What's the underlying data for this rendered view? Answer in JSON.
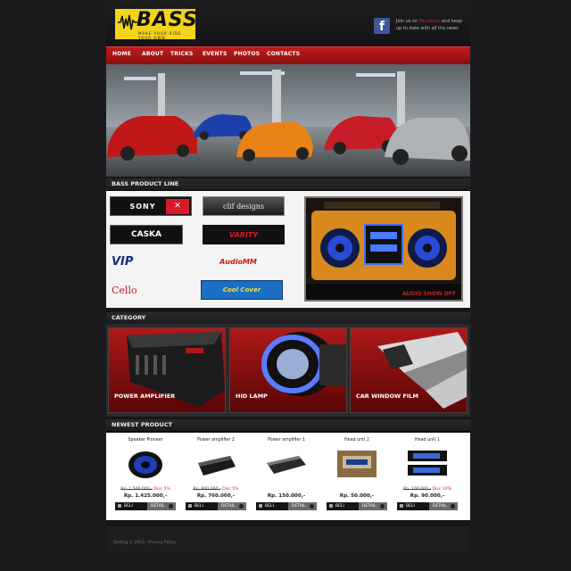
{
  "logo": {
    "text": "BASS",
    "tagline": "MAKE YOUR RIDE YOUR OWN"
  },
  "social": {
    "pre": "Join us on ",
    "highlight": "Facebook",
    "post": " and keep up to date with all the news"
  },
  "nav": [
    "HOME",
    "ABOUT",
    "TRICKS",
    "EVENTS",
    "PHOTOS",
    "CONTACTS"
  ],
  "sections": {
    "product_line": "BASS PRODUCT LINE",
    "category": "CATEGORY",
    "newest": "NEWEST PRODUCT"
  },
  "brands": [
    "SONY",
    "clif designs",
    "CASKA",
    "VARITY",
    "VIP",
    "AudioMM",
    "Cello",
    "Cool Cover"
  ],
  "showoff_label": "AUDIO SHOW OFF",
  "categories": [
    "POWER AMPLIFIER",
    "HID LAMP",
    "CAR WINDOW FILM"
  ],
  "products": [
    {
      "name": "Speaker Pioneer",
      "old": "Rp. 1.500.000,-",
      "disc": "Disc 5%",
      "price": "Rp. 1.425.000,-",
      "buy": "BELI",
      "detail": "DETAIL"
    },
    {
      "name": "Power amplifier 2",
      "old": "Rp. 800.000,-",
      "disc": "Disc 5%",
      "price": "Rp. 760.000,-",
      "buy": "BELI",
      "detail": "DETAIL"
    },
    {
      "name": "Power amplifier 1",
      "old": "",
      "disc": "",
      "price": "Rp. 150.000,-",
      "buy": "BELI",
      "detail": "DETAIL"
    },
    {
      "name": "Head unit 2",
      "old": "",
      "disc": "",
      "price": "Rp. 50.000,-",
      "buy": "BELI",
      "detail": "DETAIL"
    },
    {
      "name": "Head unit 1",
      "old": "Rp. 100.000,-",
      "disc": "Disc 10%",
      "price": "Rp. 90.000,-",
      "buy": "BELI",
      "detail": "DETAIL"
    }
  ],
  "footer": "Sorting © 2013 · Privacy Policy",
  "colors": {
    "accent": "#c11c1c",
    "logo_bg": "#f2d41b",
    "page_bg": "#1b1b1d",
    "facebook": "#3b5998"
  }
}
